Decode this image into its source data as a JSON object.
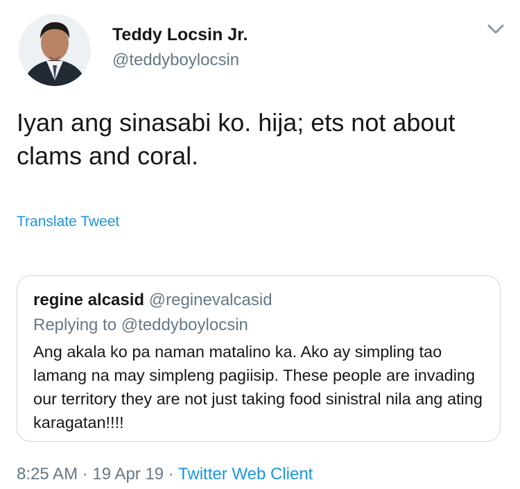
{
  "author": {
    "name": "Teddy Locsin Jr.",
    "handle": "@teddyboylocsin"
  },
  "tweet": {
    "text": "Iyan ang sinasabi ko. hija; ets not about clams and coral.",
    "translate_label": "Translate Tweet"
  },
  "quoted": {
    "name": "regine alcasid",
    "handle": "@reginevalcasid",
    "replying_to": "Replying to @teddyboylocsin",
    "text": "Ang akala ko pa naman matalino ka. Ako ay simpling tao lamang na may simpleng pagiisip. These people are invading our territory they are not just taking food sinistral nila ang ating karagatan!!!!"
  },
  "meta": {
    "time": "8:25 AM",
    "sep1": " · ",
    "date": "19 Apr 19",
    "sep2": " · ",
    "client": "Twitter Web Client"
  },
  "icons": {
    "chevron": "chevron-down-icon",
    "avatar": "profile-photo"
  },
  "colors": {
    "link": "#1b95e0",
    "secondary_text": "#657786",
    "border": "#ccd6dd"
  }
}
